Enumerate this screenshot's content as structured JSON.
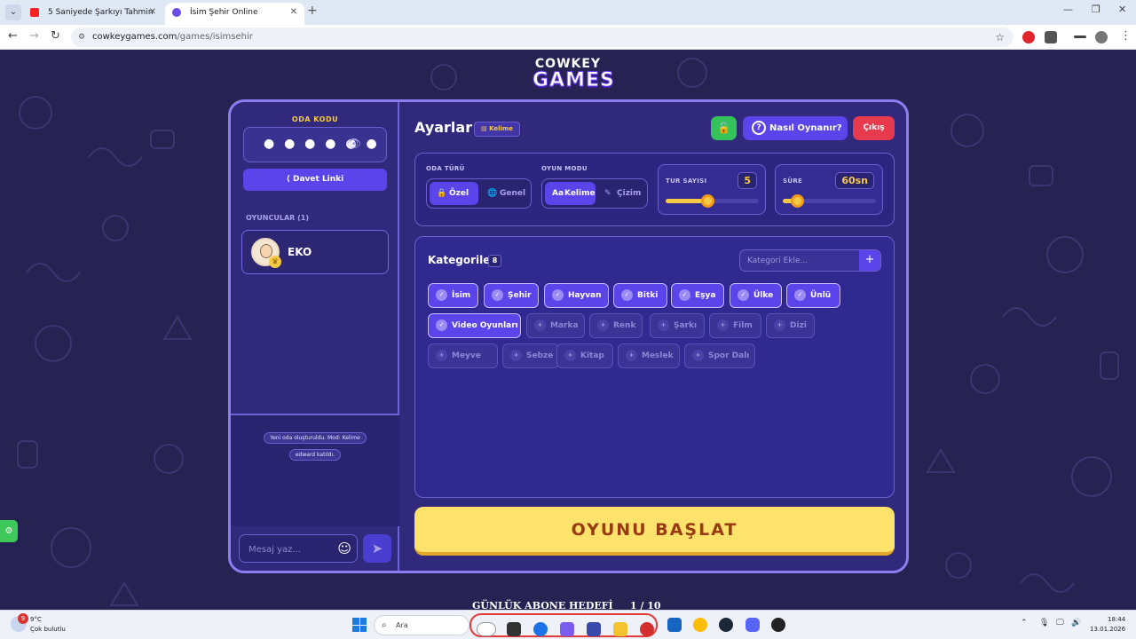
{
  "browser": {
    "tabs": [
      {
        "title": "5 Saniyede Şarkıyı Tahmin Et"
      },
      {
        "title": "İsim Şehir Online"
      }
    ],
    "url_host": "cowkeygames.com",
    "url_path": "/games/isimsehir"
  },
  "logo": {
    "line1": "COWKEY",
    "line2": "GAMES"
  },
  "sidebar": {
    "room_code_label": "ODA KODU",
    "room_code_masked": "● ● ● ● ● ●",
    "invite_label": "Davet Linki",
    "players_label": "OYUNCULAR (1)",
    "players": [
      {
        "name": "EKO"
      }
    ],
    "chat_messages": [
      "Yeni oda oluşturuldu. Mod: Kelime",
      "edward katıldı."
    ],
    "chat_placeholder": "Mesaj yaz..."
  },
  "header": {
    "title": "Ayarlar",
    "mode_chip": "Kelime",
    "help_label": "Nasıl Oynanır?",
    "exit_label": "Çıkış"
  },
  "settings": {
    "room_type": {
      "label": "ODA TÜRÜ",
      "options": [
        "Özel",
        "Genel"
      ],
      "selected": "Özel"
    },
    "game_mode": {
      "label": "OYUN MODU",
      "options": [
        "Kelime",
        "Çizim"
      ],
      "selected": "Kelime"
    },
    "rounds": {
      "label": "TUR SAYISI",
      "value": "5",
      "slider_fraction": 0.45
    },
    "duration": {
      "label": "SÜRE",
      "value": "60sn",
      "slider_fraction": 0.15
    }
  },
  "categories": {
    "title": "Kategoriler",
    "count": "8",
    "add_placeholder": "Kategori Ekle...",
    "items": [
      {
        "label": "İsim",
        "selected": true
      },
      {
        "label": "Şehir",
        "selected": true
      },
      {
        "label": "Hayvan",
        "selected": true
      },
      {
        "label": "Bitki",
        "selected": true
      },
      {
        "label": "Eşya",
        "selected": true
      },
      {
        "label": "Ülke",
        "selected": true
      },
      {
        "label": "Ünlü",
        "selected": true
      },
      {
        "label": "Video Oyunları",
        "selected": true
      },
      {
        "label": "Marka",
        "selected": false
      },
      {
        "label": "Renk",
        "selected": false
      },
      {
        "label": "Şarkı",
        "selected": false
      },
      {
        "label": "Film",
        "selected": false
      },
      {
        "label": "Dizi",
        "selected": false
      },
      {
        "label": "Meyve",
        "selected": false
      },
      {
        "label": "Sebze",
        "selected": false
      },
      {
        "label": "Kitap",
        "selected": false
      },
      {
        "label": "Meslek",
        "selected": false
      },
      {
        "label": "Spor Dalı",
        "selected": false
      }
    ]
  },
  "start_label": "OYUNU BAŞLAT",
  "goal": {
    "label": "GÜNLÜK ABONE HEDEFİ",
    "progress": "1 / 10"
  },
  "taskbar": {
    "weather_badge": "9",
    "temperature": "9°C",
    "weather_desc": "Çok bulutlu",
    "search_label": "Ara",
    "time": "18:44",
    "date": "13.01.2026"
  },
  "colors": {
    "page_bg": "#262352",
    "panel_bg": "#312a7c",
    "accent": "#5a44ea",
    "gold": "#f6c945",
    "danger": "#e83a4d",
    "success": "#35c25a"
  }
}
